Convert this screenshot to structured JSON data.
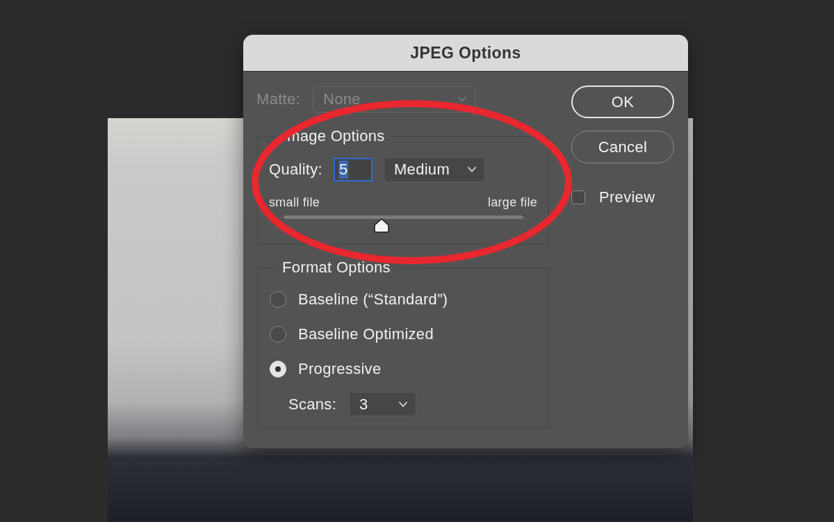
{
  "window": {
    "title": "JPEG Options"
  },
  "matte": {
    "label": "Matte:",
    "value": "None",
    "disabled": true
  },
  "image_options": {
    "title": "mage Options",
    "quality": {
      "label": "Quality:",
      "value": "5",
      "focused": true,
      "preset": "Medium"
    },
    "slider": {
      "min_label": "small file",
      "max_label": "large file",
      "level": 0.41
    }
  },
  "format_options": {
    "title": "Format Options",
    "options": [
      {
        "label": "Baseline (“Standard”)",
        "selected": false
      },
      {
        "label": "Baseline Optimized",
        "selected": false
      },
      {
        "label": "Progressive",
        "selected": true
      }
    ],
    "scans": {
      "label": "Scans:",
      "value": "3"
    }
  },
  "buttons": [
    {
      "label": "OK",
      "kind": "default"
    },
    {
      "label": "Cancel",
      "kind": "normal"
    }
  ],
  "preview": {
    "label": "Preview",
    "checked": false
  }
}
